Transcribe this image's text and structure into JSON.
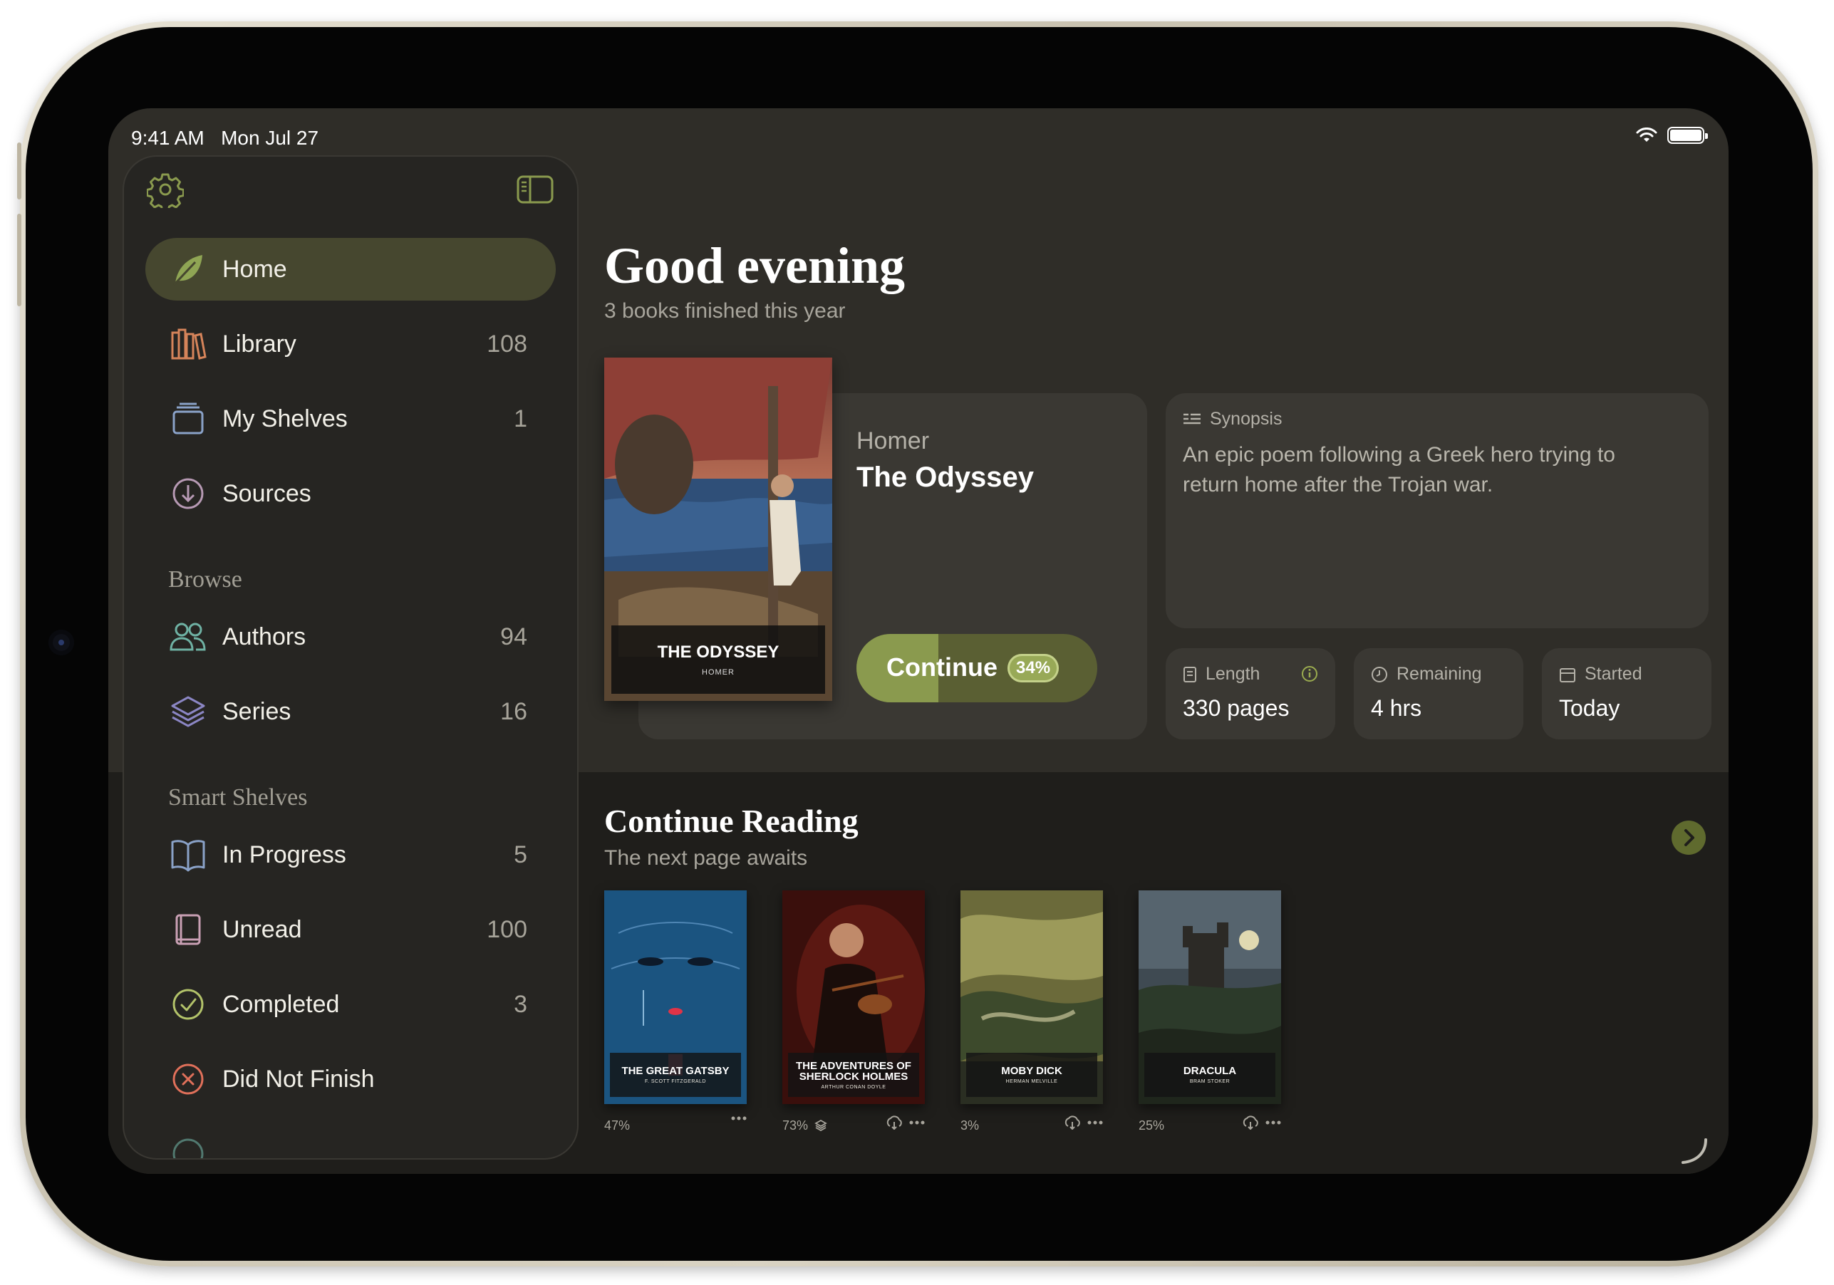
{
  "status_bar": {
    "time": "9:41 AM",
    "date": "Mon Jul 27"
  },
  "sidebar": {
    "nav": [
      {
        "label": "Home",
        "count": "",
        "icon": "leaf-icon",
        "active": true
      },
      {
        "label": "Library",
        "count": "108",
        "icon": "books-icon"
      },
      {
        "label": "My Shelves",
        "count": "1",
        "icon": "shelves-icon"
      },
      {
        "label": "Sources",
        "count": "",
        "icon": "download-circle-icon"
      }
    ],
    "browse_header": "Browse",
    "browse": [
      {
        "label": "Authors",
        "count": "94",
        "icon": "people-icon"
      },
      {
        "label": "Series",
        "count": "16",
        "icon": "stack-icon"
      }
    ],
    "smart_header": "Smart Shelves",
    "smart": [
      {
        "label": "In Progress",
        "count": "5",
        "icon": "open-book-icon"
      },
      {
        "label": "Unread",
        "count": "100",
        "icon": "closed-book-icon"
      },
      {
        "label": "Completed",
        "count": "3",
        "icon": "checkmark-circle-icon"
      },
      {
        "label": "Did Not Finish",
        "count": "",
        "icon": "x-circle-icon"
      }
    ]
  },
  "main": {
    "greeting": "Good evening",
    "subtitle": "3 books finished this year",
    "hero": {
      "cover_title": "THE ODYSSEY",
      "cover_author": "HOMER",
      "author": "Homer",
      "title": "The Odyssey",
      "button_label": "Continue",
      "progress_label": "34%",
      "progress": 0.34
    },
    "synopsis": {
      "header": "Synopsis",
      "text": "An epic poem following a Greek hero trying to return home after the Trojan war."
    },
    "stats": [
      {
        "label": "Length",
        "value": "330 pages"
      },
      {
        "label": "Remaining",
        "value": "4 hrs"
      },
      {
        "label": "Started",
        "value": "Today"
      }
    ],
    "continue_reading": {
      "title": "Continue Reading",
      "subtitle": "The next page awaits",
      "books": [
        {
          "cover_title": "THE GREAT GATSBY",
          "cover_author": "F. SCOTT FITZGERALD",
          "progress": "47%"
        },
        {
          "cover_title": "THE ADVENTURES OF SHERLOCK HOLMES",
          "cover_author": "ARTHUR CONAN DOYLE",
          "progress": "73%"
        },
        {
          "cover_title": "MOBY DICK",
          "cover_author": "HERMAN MELVILLE",
          "progress": "3%"
        },
        {
          "cover_title": "DRACULA",
          "cover_author": "BRAM STOKER",
          "progress": "25%"
        }
      ]
    }
  },
  "colors": {
    "accent": "#8a9a4e",
    "background": "#2f2d28",
    "sidebar": "#262522",
    "card": "#3a3833"
  }
}
